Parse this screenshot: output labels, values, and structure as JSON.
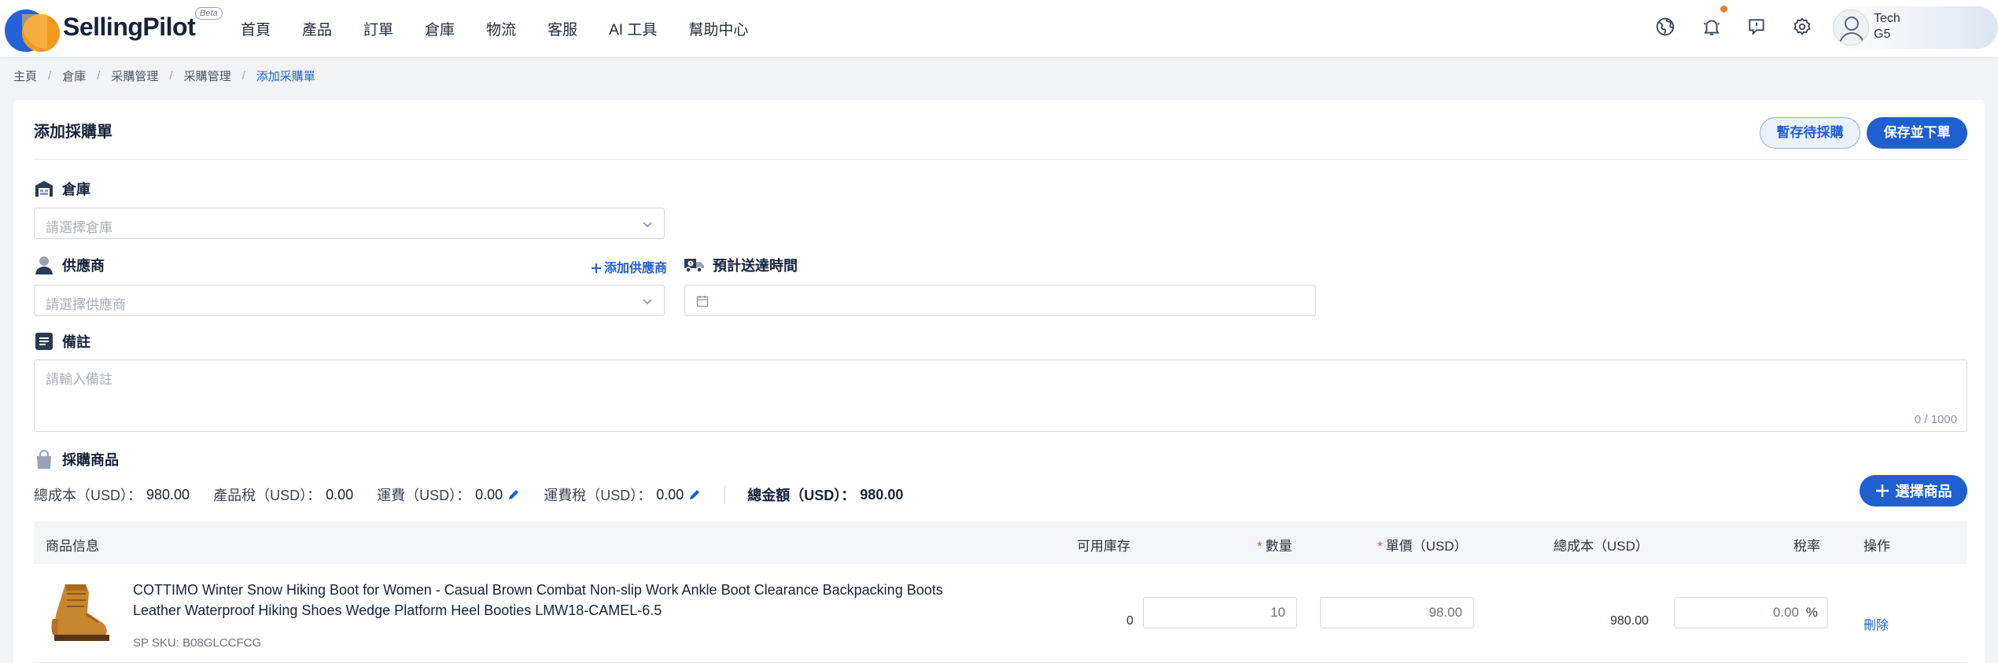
{
  "brand": {
    "name": "SellingPilot",
    "badge": "Beta"
  },
  "nav": [
    "首頁",
    "產品",
    "訂單",
    "倉庫",
    "物流",
    "客服",
    "AI 工具",
    "幫助中心"
  ],
  "user": {
    "line1": "Tech",
    "line2": "G5"
  },
  "breadcrumb": [
    "主頁",
    "倉庫",
    "采購管理",
    "采購管理",
    "添加采購單"
  ],
  "page": {
    "title": "添加採購單",
    "save_draft_label": "暫存待採購",
    "save_order_label": "保存並下單"
  },
  "form": {
    "warehouse": {
      "label": "倉庫",
      "placeholder": "請選擇倉庫"
    },
    "supplier": {
      "label": "供應商",
      "placeholder": "請選擇供應商",
      "add_label": "添加供應商"
    },
    "eta": {
      "label": "預計送達時間",
      "value": ""
    },
    "notes": {
      "label": "備註",
      "placeholder": "請輸入備註",
      "counter": "0 / 1000"
    }
  },
  "purchase": {
    "label": "採購商品",
    "summary": [
      {
        "label": "總成本（USD）：",
        "value": "980.00",
        "editable": false
      },
      {
        "label": "產品稅（USD）：",
        "value": "0.00",
        "editable": false
      },
      {
        "label": "運費（USD）：",
        "value": "0.00",
        "editable": true
      },
      {
        "label": "運費稅（USD）：",
        "value": "0.00",
        "editable": true
      }
    ],
    "total_label": "總金額（USD）：",
    "total_value": "980.00",
    "select_button_label": "選擇商品"
  },
  "table": {
    "columns": {
      "info": "商品信息",
      "stock": "可用庫存",
      "qty": "數量",
      "price": "單價（USD）",
      "cost": "總成本（USD）",
      "tax": "稅率",
      "action": "操作"
    },
    "rows": [
      {
        "name": "COTTIMO Winter Snow Hiking Boot for Women - Casual Brown Combat Non-slip Work Ankle Boot Clearance Backpacking Boots Leather Waterproof Hiking Shoes Wedge Platform Heel Booties LMW18-CAMEL-6.5",
        "sku": "SP SKU: B08GLCCFCG",
        "stock": "0",
        "qty": "10",
        "price": "98.00",
        "cost": "980.00",
        "tax": "0.00",
        "tax_unit": "%",
        "action": "刪除"
      }
    ]
  },
  "colors": {
    "primary": "#1f5fd0",
    "accent": "#f39a1e",
    "required": "#e5484d"
  }
}
